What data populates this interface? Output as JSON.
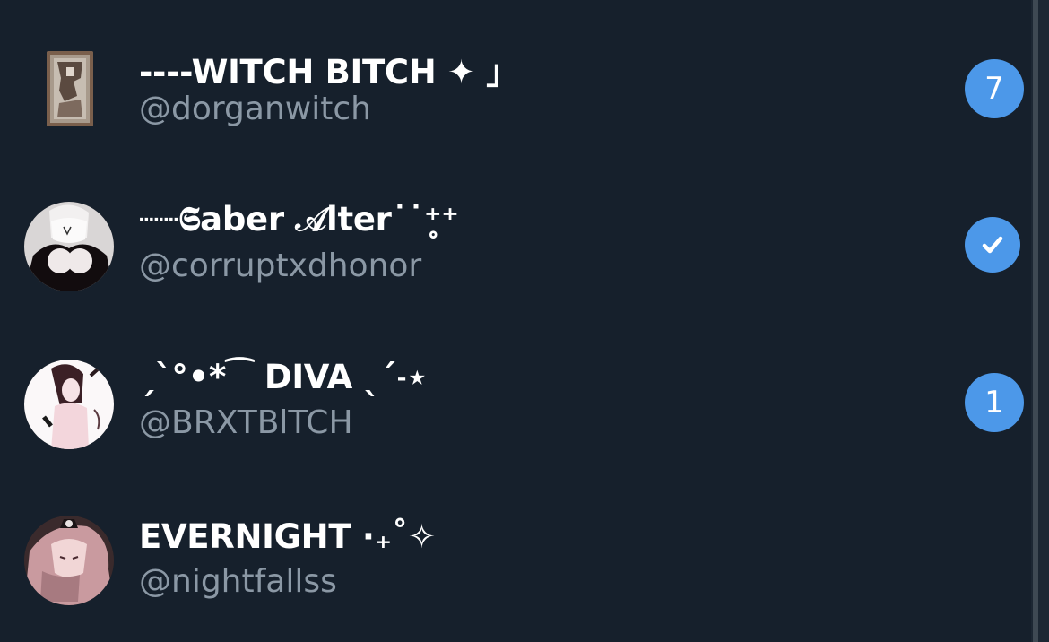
{
  "conversations": [
    {
      "display_name": "----WITCH BITCH ✦ 」",
      "handle": "@dorganwitch",
      "badge": "7",
      "avatar_icon": "avatar-card-image"
    },
    {
      "display_name": "┈┈𝕾aber 𝒜lter˙˙⁺̥⁺",
      "handle": "@corruptxdhonor",
      "badge_icon": "checkmark-icon",
      "avatar_icon": "avatar-monochrome-character"
    },
    {
      "display_name": "ˏˋ°•*⁀ DIVA ˎˊ˗⋆",
      "handle": "@BRXTBlTCH",
      "badge": "1",
      "avatar_icon": "avatar-character-pink"
    },
    {
      "display_name": "EVERNIGHT ·₊˚✧",
      "handle": "@nightfallss",
      "avatar_icon": "avatar-character-pink-hair"
    }
  ],
  "colors": {
    "background": "#16202c",
    "primary_text": "#ffffff",
    "secondary_text": "#8b98a5",
    "badge_blue": "#4c98e9"
  }
}
